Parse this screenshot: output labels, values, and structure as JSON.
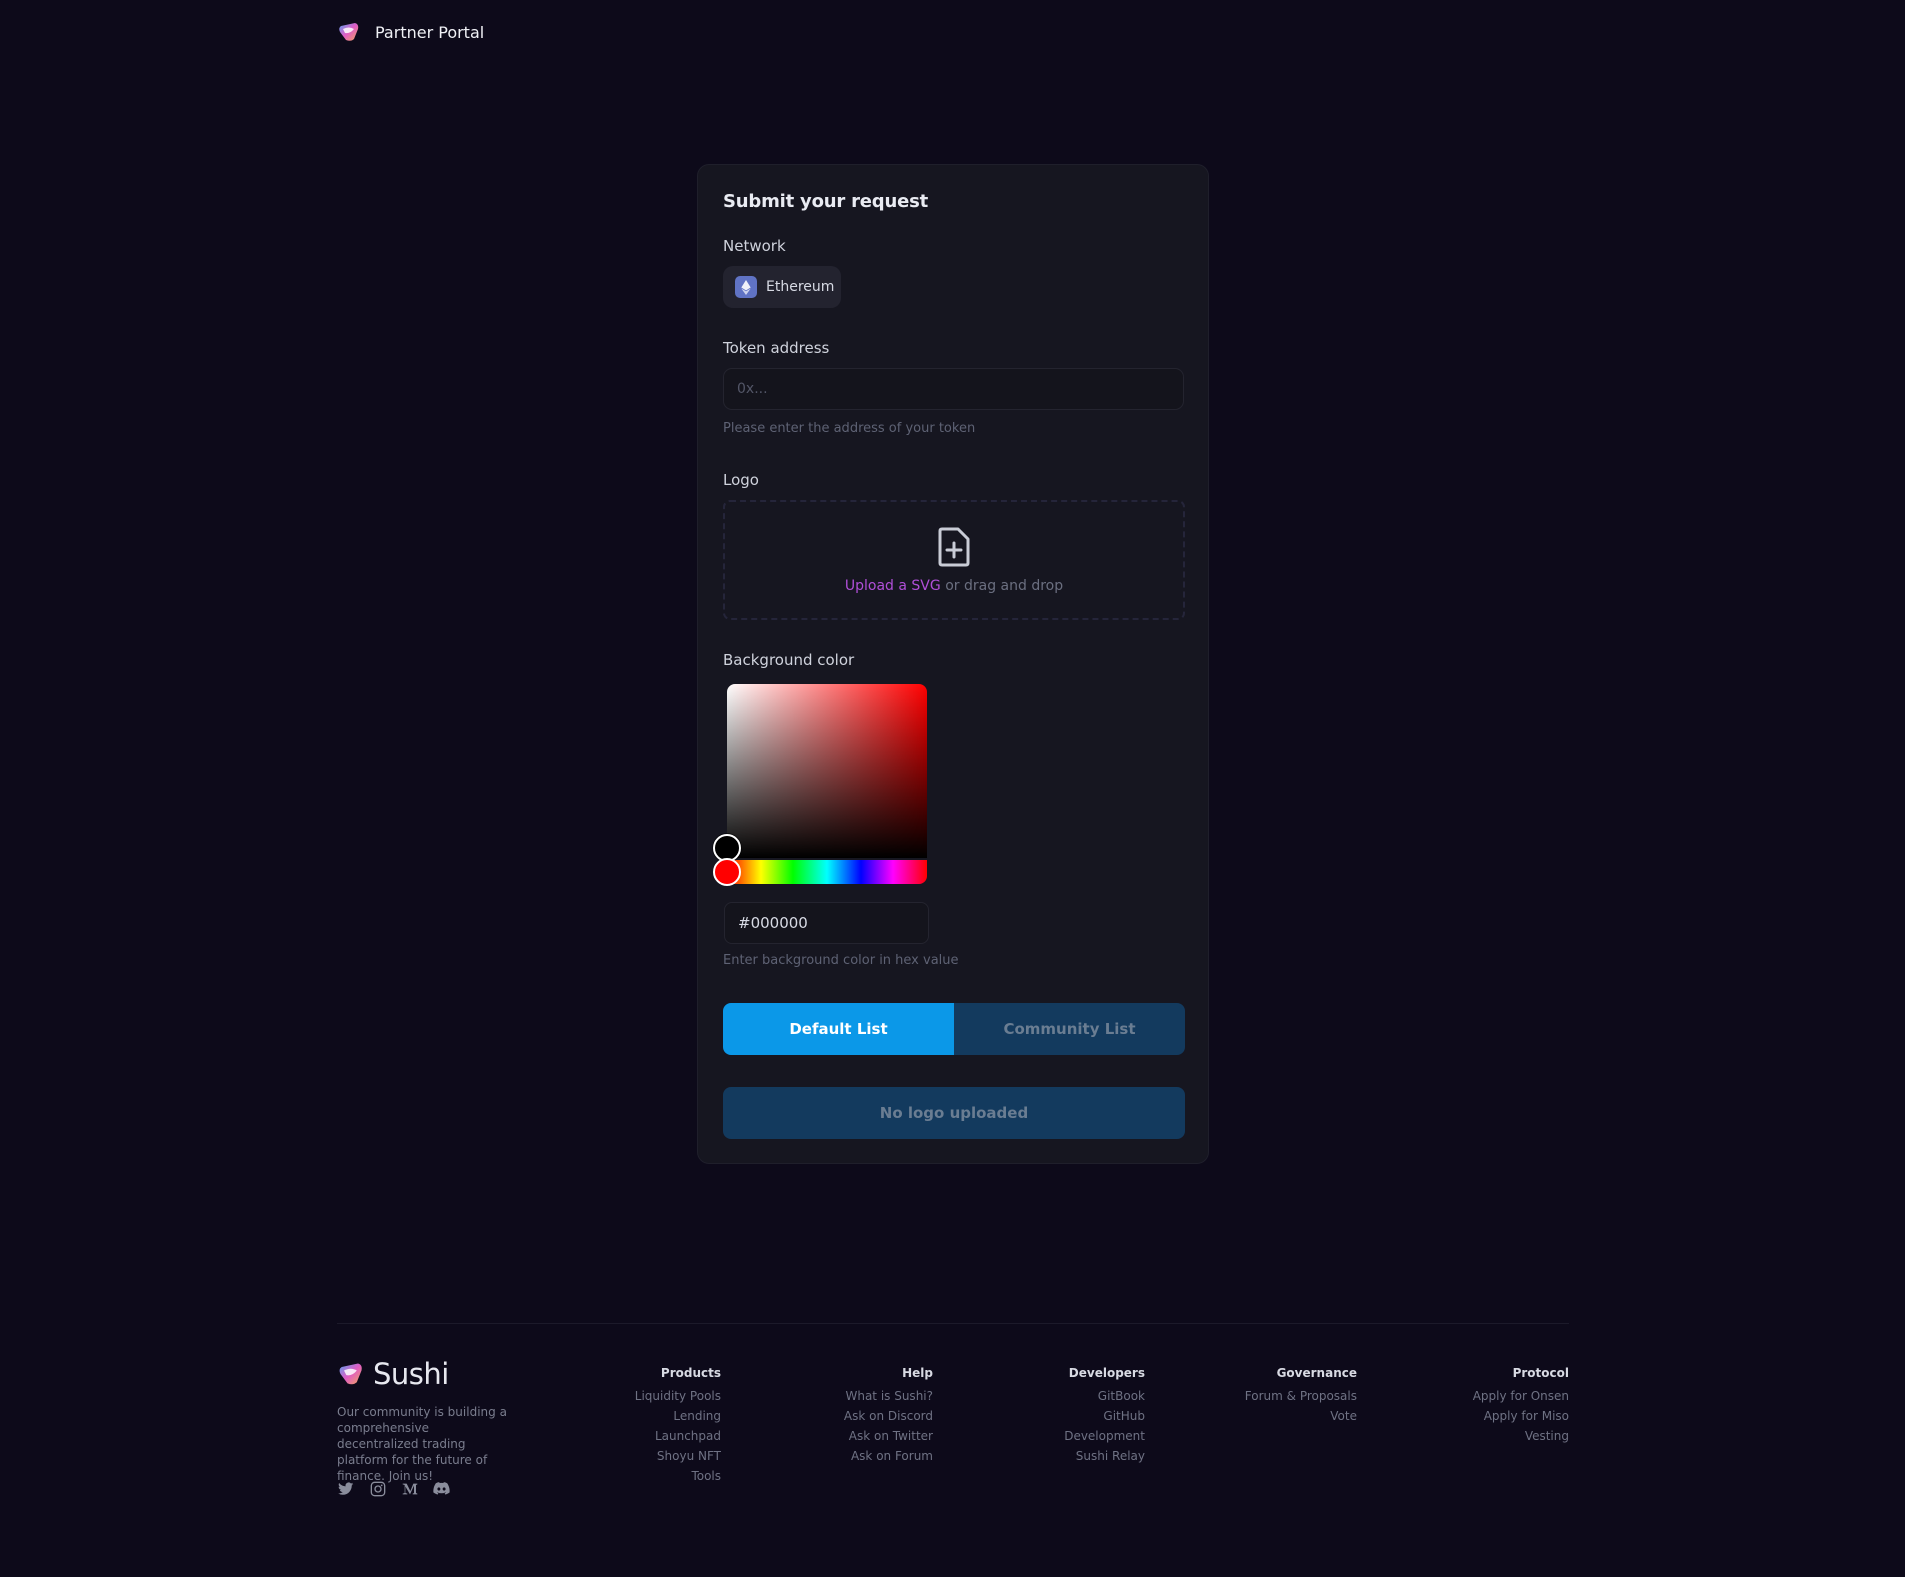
{
  "header": {
    "title": "Partner Portal",
    "logo_icon": "sushi-logo-icon"
  },
  "form": {
    "title": "Submit your request",
    "network": {
      "label": "Network",
      "selected": "Ethereum",
      "icon": "ethereum-icon"
    },
    "token_address": {
      "label": "Token address",
      "placeholder": "0x...",
      "value": "",
      "helper": "Please enter the address of your token"
    },
    "logo": {
      "label": "Logo",
      "upload_link": "Upload a SVG",
      "upload_suffix": " or drag and drop",
      "icon": "file-plus-icon"
    },
    "background_color": {
      "label": "Background color",
      "value": "#000000",
      "helper": "Enter background color in hex value",
      "hue": "#ff0000"
    },
    "list_tabs": [
      {
        "label": "Default List",
        "active": true
      },
      {
        "label": "Community List",
        "active": false
      }
    ],
    "submit_label": "No logo uploaded"
  },
  "footer": {
    "brand_name": "Sushi",
    "description": "Our community is building a comprehensive decentralized trading platform for the future of finance. Join us!",
    "socials": [
      "twitter-icon",
      "instagram-icon",
      "medium-icon",
      "discord-icon"
    ],
    "columns": [
      {
        "title": "Products",
        "links": [
          "Liquidity Pools",
          "Lending",
          "Launchpad",
          "Shoyu NFT",
          "Tools"
        ]
      },
      {
        "title": "Help",
        "links": [
          "What is Sushi?",
          "Ask on Discord",
          "Ask on Twitter",
          "Ask on Forum"
        ]
      },
      {
        "title": "Developers",
        "links": [
          "GitBook",
          "GitHub",
          "Development",
          "Sushi Relay"
        ]
      },
      {
        "title": "Governance",
        "links": [
          "Forum & Proposals",
          "Vote"
        ]
      },
      {
        "title": "Protocol",
        "links": [
          "Apply for Onsen",
          "Apply for Miso",
          "Vesting"
        ]
      }
    ]
  },
  "colors": {
    "background": "#0d0a1a",
    "card": "#161620",
    "accent_blue": "#0b98e8",
    "muted_blue": "#133a5e",
    "link_purple": "#b04fd8"
  }
}
